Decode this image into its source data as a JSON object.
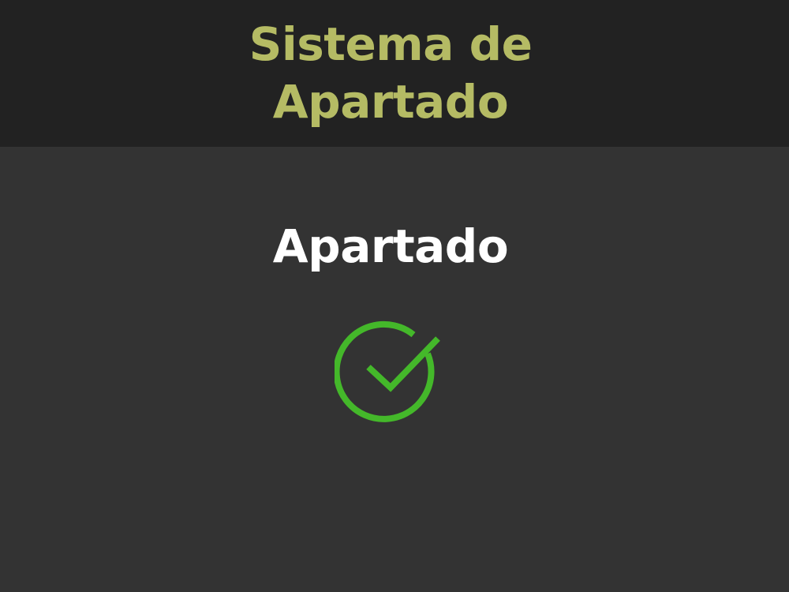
{
  "header": {
    "title_line1": "Sistema de",
    "title_line2": "Apartado",
    "title_color": "#b5bb64",
    "background": "#222222"
  },
  "main": {
    "status_text": "Apartado",
    "status_icon": "check-circle-icon",
    "icon_color": "#44b82a",
    "background": "#333333"
  }
}
